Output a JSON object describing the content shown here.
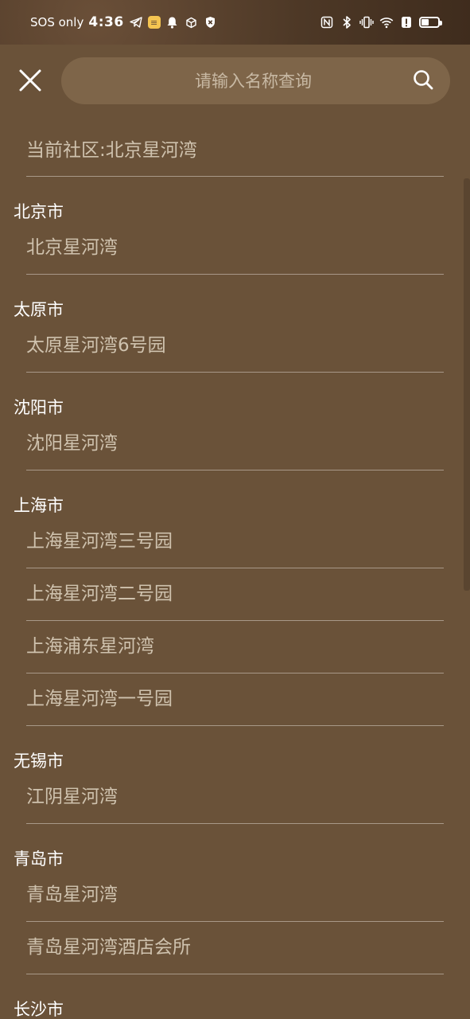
{
  "status_bar": {
    "carrier": "SOS only",
    "time": "4:36",
    "battery_level_percent": 45
  },
  "search": {
    "placeholder": "请输入名称查询",
    "value": ""
  },
  "current": {
    "label": "当前社区:北京星河湾"
  },
  "cities": [
    {
      "name": "北京市",
      "communities": [
        "北京星河湾"
      ]
    },
    {
      "name": "太原市",
      "communities": [
        "太原星河湾6号园"
      ]
    },
    {
      "name": "沈阳市",
      "communities": [
        "沈阳星河湾"
      ]
    },
    {
      "name": "上海市",
      "communities": [
        "上海星河湾三号园",
        "上海星河湾二号园",
        "上海浦东星河湾",
        "上海星河湾一号园"
      ]
    },
    {
      "name": "无锡市",
      "communities": [
        "江阴星河湾"
      ]
    },
    {
      "name": "青岛市",
      "communities": [
        "青岛星河湾",
        "青岛星河湾酒店会所"
      ]
    },
    {
      "name": "长沙市",
      "communities": []
    }
  ],
  "colors": {
    "background": "#6a5239",
    "search_bg": "#7e6549",
    "divider": "#a89888",
    "item_text": "#cfc2ae",
    "header_text": "#ffffff"
  }
}
